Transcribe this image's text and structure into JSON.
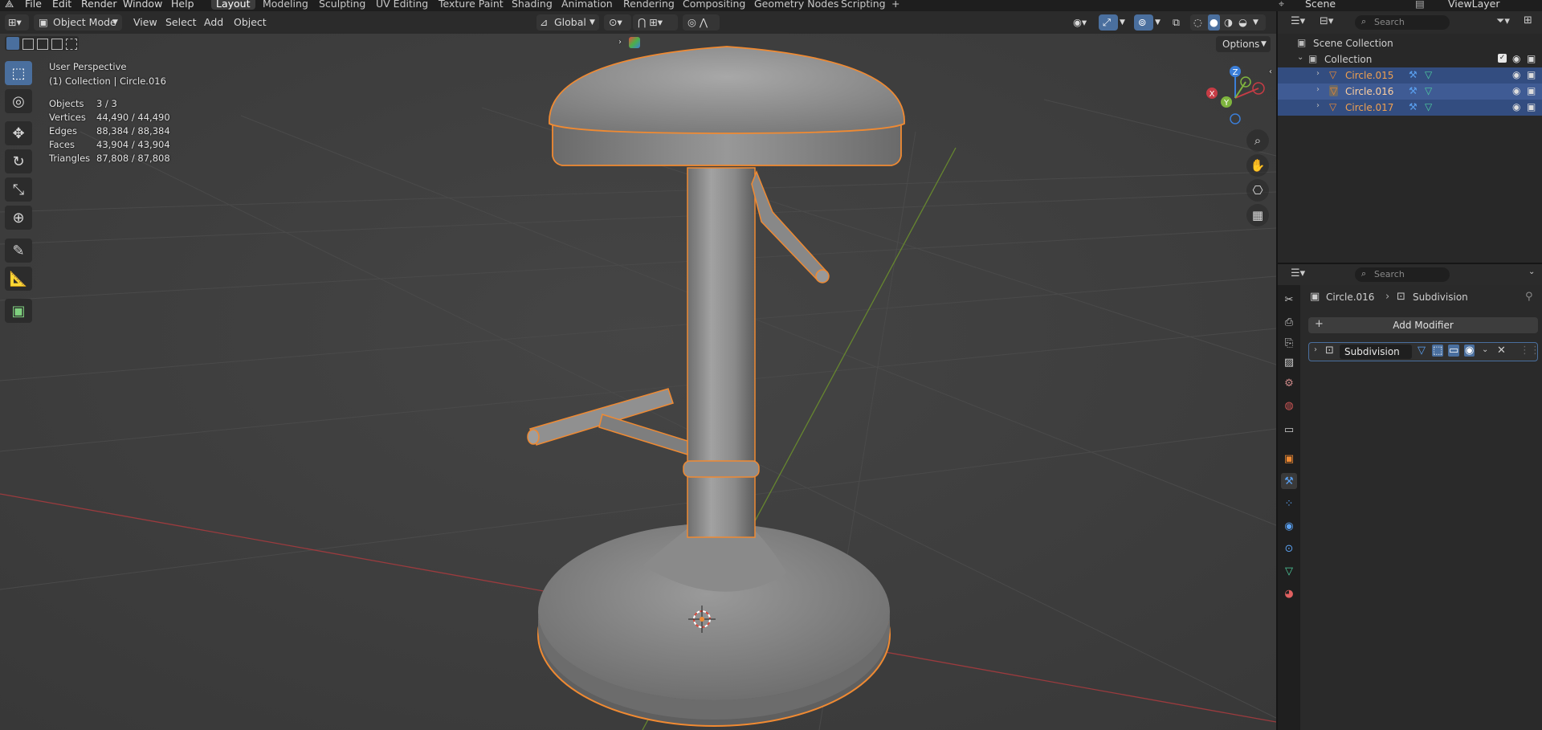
{
  "menu": {
    "items": [
      "File",
      "Edit",
      "Render",
      "Window",
      "Help"
    ],
    "workspaces": [
      "Layout",
      "Modeling",
      "Sculpting",
      "UV Editing",
      "Texture Paint",
      "Shading",
      "Animation",
      "Rendering",
      "Compositing",
      "Geometry Nodes",
      "Scripting"
    ],
    "active_workspace": "Layout",
    "scene_name": "Scene",
    "view_layer": "ViewLayer"
  },
  "viewport_header": {
    "mode": "Object Mode",
    "menus": [
      "View",
      "Select",
      "Add",
      "Object"
    ],
    "transform_orientation": "Global",
    "options_label": "Options"
  },
  "overlay": {
    "view_name": "User Perspective",
    "collection_info": "(1) Collection | Circle.016",
    "stats": [
      {
        "label": "Objects",
        "value": "3 / 3"
      },
      {
        "label": "Vertices",
        "value": "44,490 / 44,490"
      },
      {
        "label": "Edges",
        "value": "88,384 / 88,384"
      },
      {
        "label": "Faces",
        "value": "43,904 / 43,904"
      },
      {
        "label": "Triangles",
        "value": "87,808 / 87,808"
      }
    ]
  },
  "gizmo": {
    "z": "Z",
    "y": "Y",
    "x": "X"
  },
  "outliner": {
    "search_placeholder": "Search",
    "scene_collection": "Scene Collection",
    "collection": "Collection",
    "objects": [
      {
        "name": "Circle.015",
        "state": "selected"
      },
      {
        "name": "Circle.016",
        "state": "active"
      },
      {
        "name": "Circle.017",
        "state": "selected"
      }
    ]
  },
  "properties": {
    "search_placeholder": "Search",
    "breadcrumb_object": "Circle.016",
    "breadcrumb_modifier": "Subdivision",
    "add_modifier_label": "Add Modifier",
    "modifier_name": "Subdivision"
  },
  "colors": {
    "selection_orange": "#f08a32",
    "active_row": "#3f5b94",
    "x_axis": "#c63c45",
    "y_axis": "#7fb53e",
    "z_axis": "#3b7ed8",
    "accent_blue": "#4a6f9e"
  }
}
